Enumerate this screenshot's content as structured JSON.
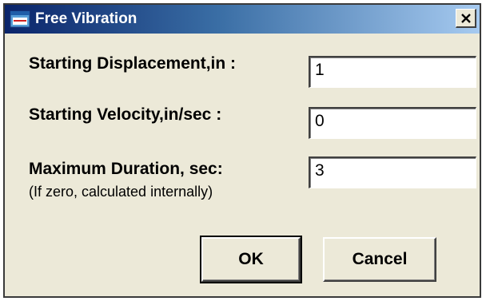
{
  "window": {
    "title": "Free Vibration",
    "icon": "app-icon",
    "close_glyph": "✕"
  },
  "fields": {
    "displacement": {
      "label": "Starting Displacement,in :",
      "value": "1"
    },
    "velocity": {
      "label": "Starting Velocity,in/sec :",
      "value": "0"
    },
    "duration": {
      "label": "Maximum Duration, sec:",
      "note": "(If zero, calculated internally)",
      "value": "3"
    }
  },
  "buttons": {
    "ok_label": "OK",
    "cancel_label": "Cancel"
  },
  "colors": {
    "titlebar_start": "#0a246a",
    "titlebar_end": "#a6caf0",
    "face": "#ece9d8"
  }
}
